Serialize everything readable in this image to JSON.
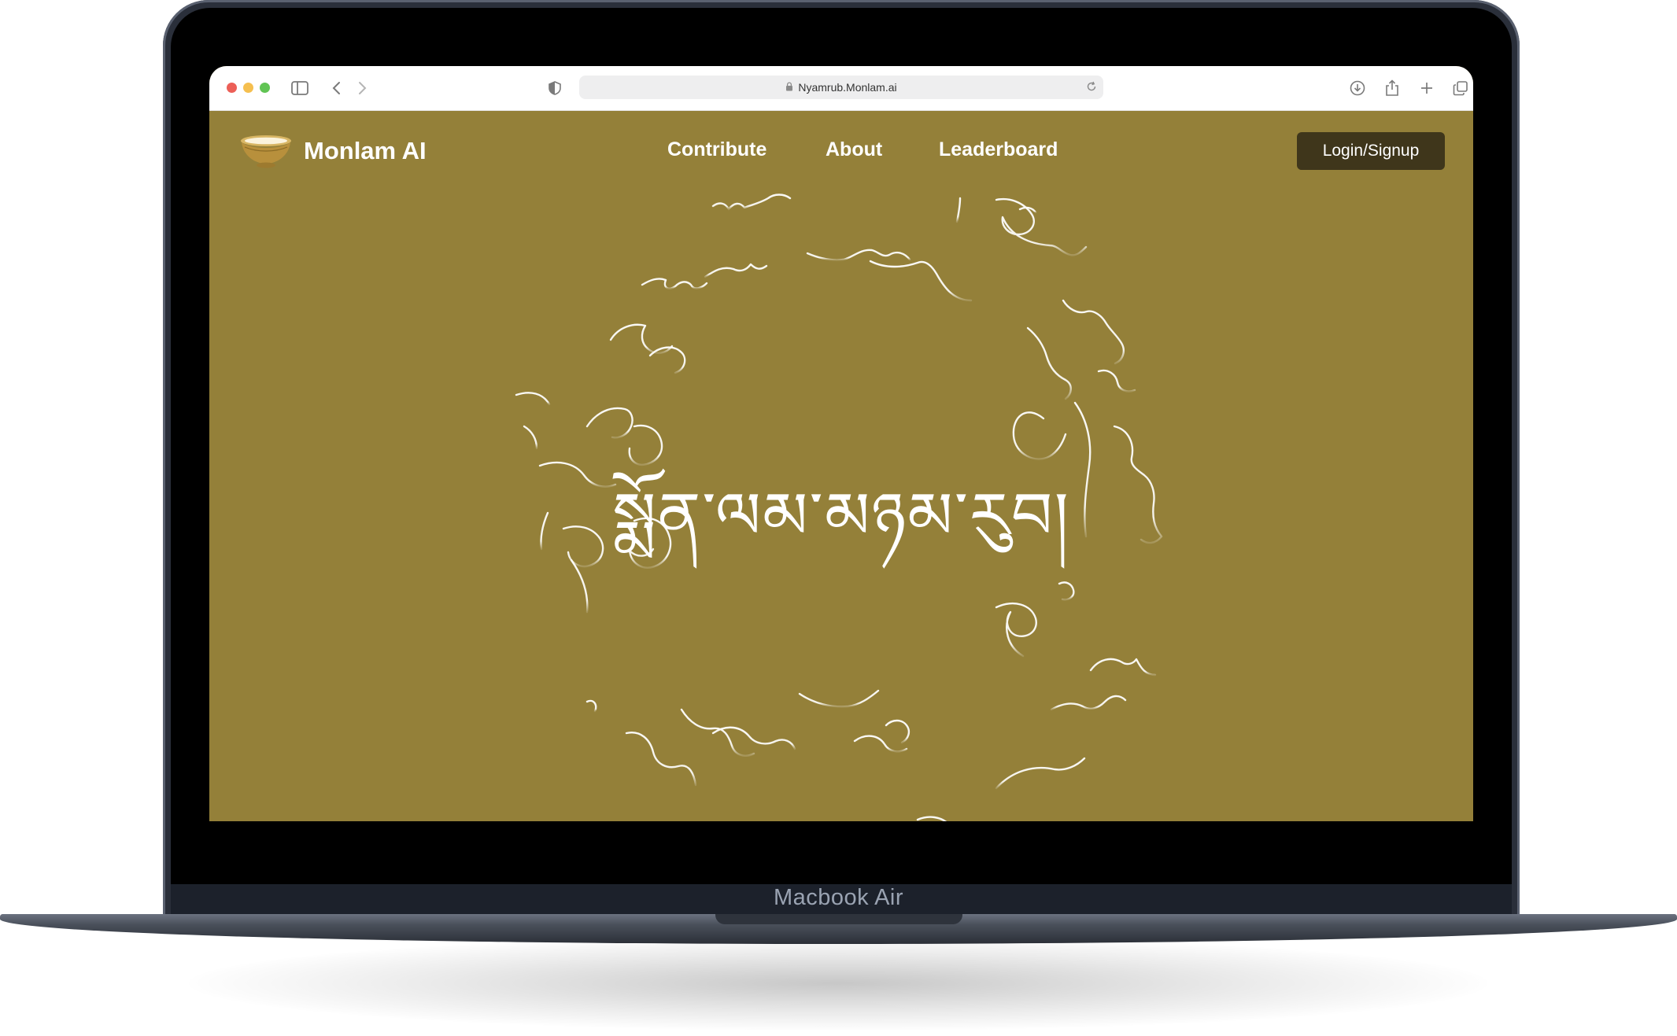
{
  "device": {
    "label": "Macbook Air"
  },
  "browser": {
    "url": "Nyamrub.Monlam.ai",
    "traffic_lights": {
      "close": "#ec5f57",
      "minimize": "#f5bf4f",
      "zoom": "#61c454"
    }
  },
  "site": {
    "brand": "Monlam AI",
    "nav": {
      "contribute": "Contribute",
      "about": "About",
      "leaderboard": "Leaderboard"
    },
    "login_label": "Login/Signup",
    "hero_title": "སྨོན་ལམ་མཉམ་རུབ།",
    "colors": {
      "background": "#948039",
      "button": "#3f361b",
      "text": "#ffffff"
    },
    "hero_art": "tibetan-calligraphy-ring"
  }
}
